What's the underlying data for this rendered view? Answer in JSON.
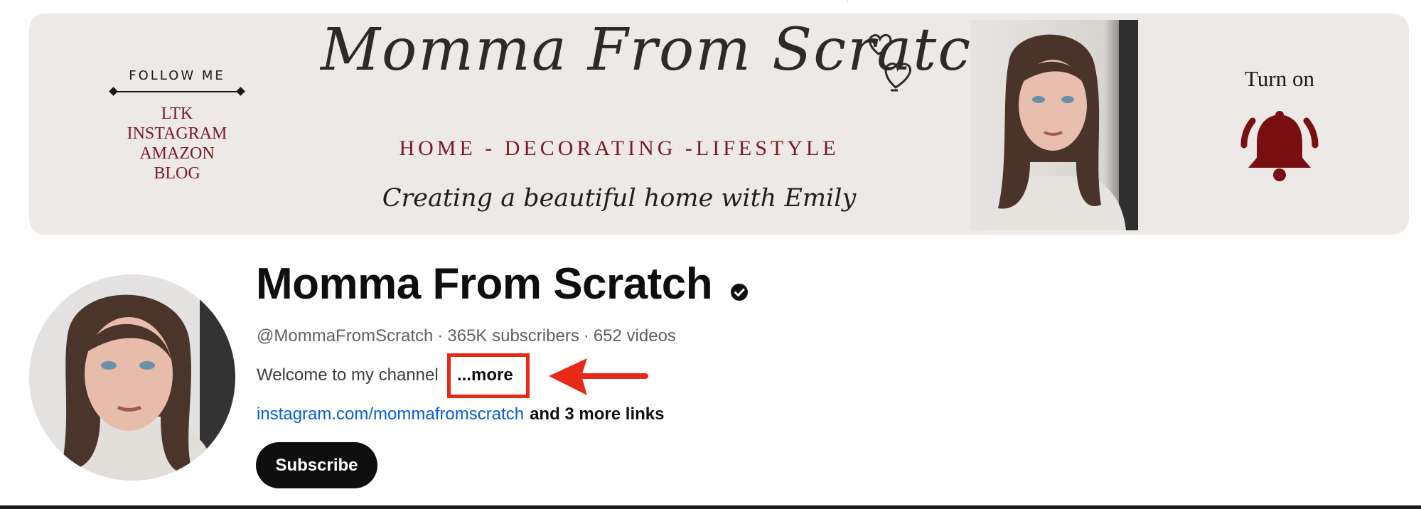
{
  "banner": {
    "follow_title": "FOLLOW ME",
    "follow_links": [
      "LTK",
      "INSTAGRAM",
      "AMAZON",
      "BLOG"
    ],
    "script_title": "Momma From Scratch",
    "tagline": "HOME - DECORATING -LIFESTYLE",
    "subtitle": "Creating a beautiful home with Emily",
    "turn_on": "Turn on",
    "accent_color": "#7a0f12"
  },
  "channel": {
    "name": "Momma From Scratch",
    "handle": "@MommaFromScratch",
    "subscribers": "365K subscribers",
    "videos": "652 videos",
    "separator": "·",
    "description": "Welcome to my channel",
    "more_label": "...more",
    "link_url": "instagram.com/mommafromscratch",
    "more_links": "and 3 more links",
    "subscribe_label": "Subscribe"
  },
  "annotation": {
    "highlight_color": "#e8291a"
  }
}
